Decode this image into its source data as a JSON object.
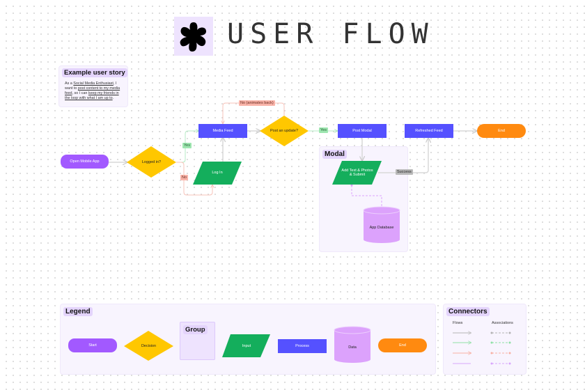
{
  "title": {
    "logo_icon": "flower-blob-icon",
    "text": "USER FLOW"
  },
  "user_story": {
    "label": "Example user story",
    "text_parts": [
      "As a ",
      "Social Media Enthusiast",
      ", I want to ",
      "post content to my media feed",
      ", so I can ",
      "keep my friends in the loop with what I am up to",
      "."
    ]
  },
  "flow": {
    "start": "Open Mobile App",
    "decision_login": "Logged in?",
    "login": "Log In",
    "media_feed": "Media Feed",
    "decision_post": "Post an update?",
    "post_modal": "Post Modal",
    "refreshed_feed": "Refreshed Feed",
    "end": "End",
    "add_text": "Add Text & Photos & Submit",
    "database": "App Database",
    "labels": {
      "yes1": "Yes",
      "no1": "No",
      "yes2": "Yes",
      "no_back": "No (animates back)",
      "success": "Success"
    }
  },
  "modal_group": {
    "label": "Modal"
  },
  "legend": {
    "label": "Legend",
    "items": {
      "start": "Start",
      "decision": "Decision",
      "group": "Group",
      "input": "Input",
      "process": "Process",
      "data": "Data",
      "end": "End"
    }
  },
  "connectors": {
    "label": "Connectors",
    "flows_header": "Flows",
    "associations_header": "Associations",
    "colors": [
      "#b3b3b3",
      "#8fe0a6",
      "#f7b0a4",
      "#d8a6fb"
    ]
  },
  "colors": {
    "purple": "#a259ff",
    "orange": "#ff8a10",
    "blue": "#5551ff",
    "green": "#14ae5c",
    "yellow": "#ffc700",
    "lilac": "#dca2fc"
  }
}
